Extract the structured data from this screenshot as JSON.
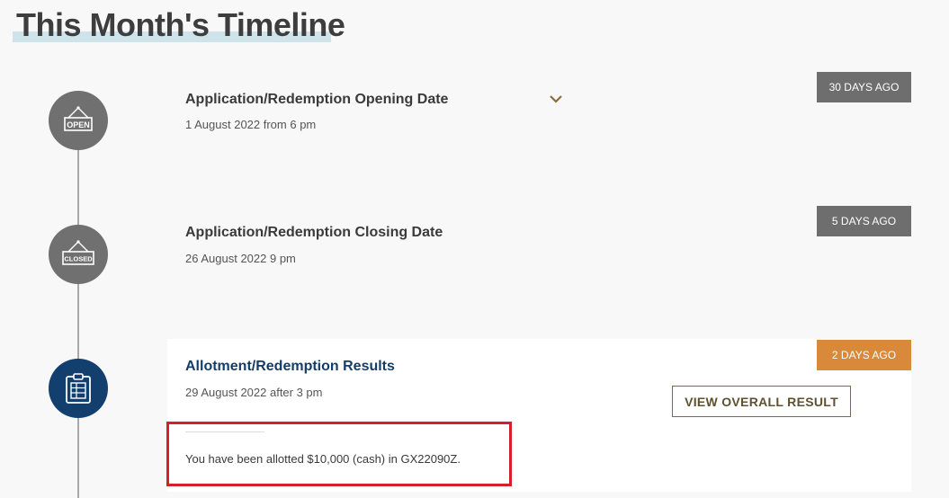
{
  "page": {
    "title": "This Month's Timeline"
  },
  "timeline": {
    "items": [
      {
        "icon": "open-sign-icon",
        "sign_text": "OPEN",
        "title": "Application/Redemption Opening Date",
        "date": "1 August 2022 from 6 pm",
        "badge": "30 DAYS AGO"
      },
      {
        "icon": "closed-sign-icon",
        "sign_text": "CLOSED",
        "title": "Application/Redemption Closing Date",
        "date": "26 August 2022 9 pm",
        "badge": "5 DAYS AGO"
      },
      {
        "icon": "clipboard-results-icon",
        "title": "Allotment/Redemption Results",
        "date": "29 August 2022 after 3 pm",
        "badge": "2 DAYS AGO",
        "button_label": "VIEW OVERALL RESULT",
        "message": "You have been allotted $10,000 (cash) in GX22090Z."
      }
    ]
  },
  "colors": {
    "background": "#f8f8f8",
    "node_inactive": "#707070",
    "node_active": "#123f6e",
    "badge_grey": "#6e6e6e",
    "badge_recent": "#d8893a",
    "highlight": "#d61f2a",
    "title_underline": "#cfe4ea"
  }
}
